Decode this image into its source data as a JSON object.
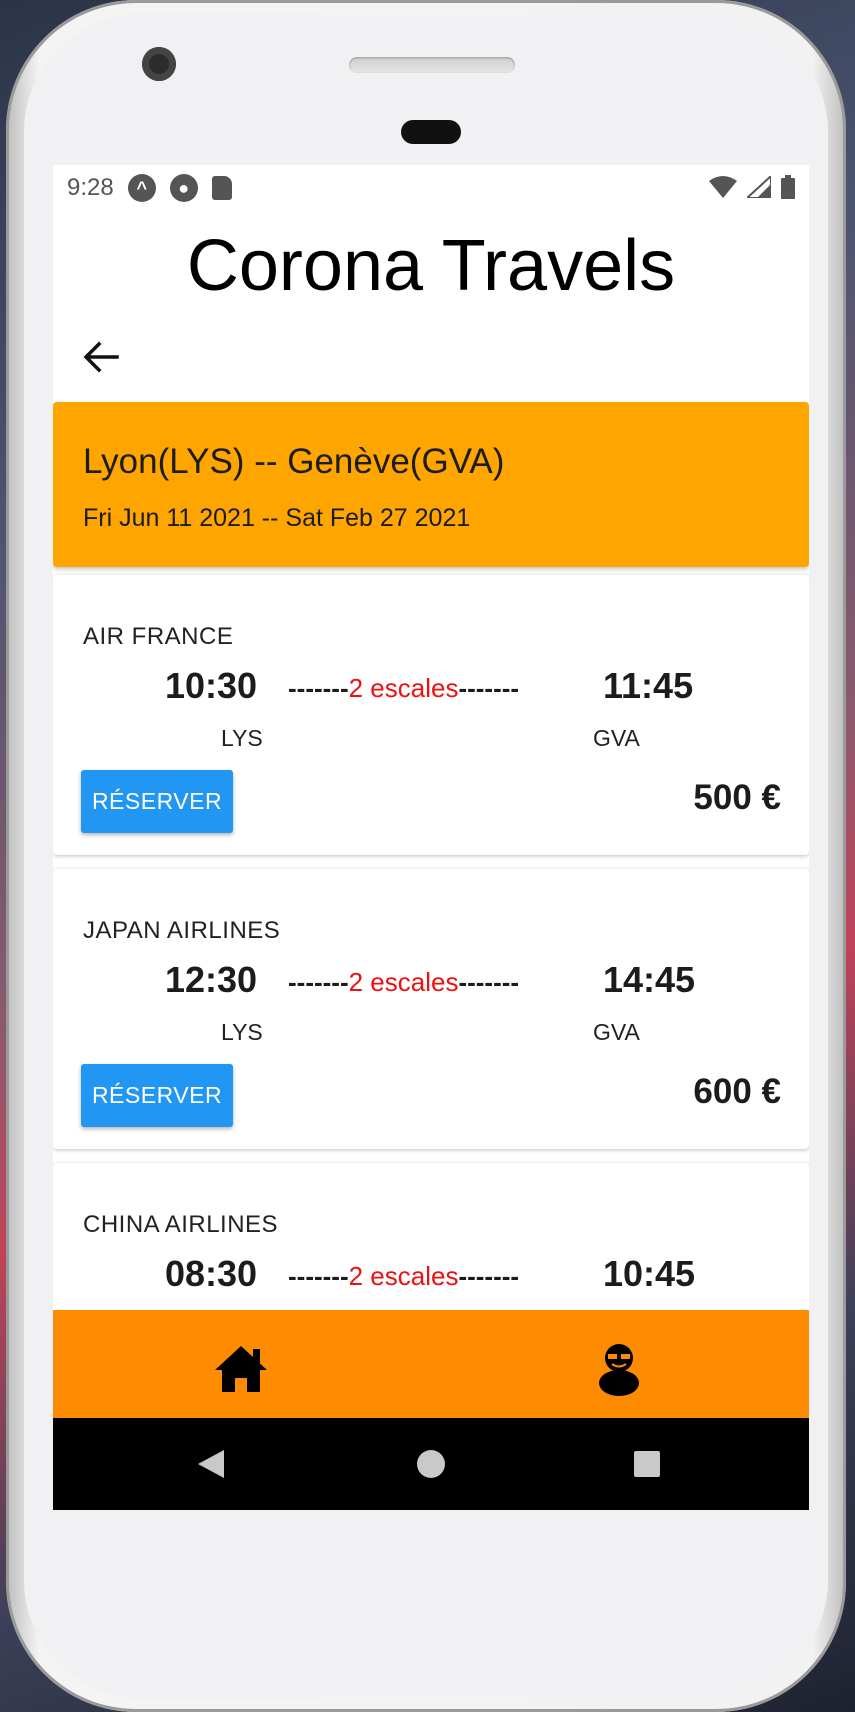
{
  "status_bar": {
    "time": "9:28",
    "icons": [
      "app-notification-icon",
      "notification-icon",
      "sd-card-icon",
      "wifi-icon",
      "signal-icon",
      "battery-icon"
    ]
  },
  "app": {
    "title": "Corona Travels",
    "back_icon": "arrow-left-icon"
  },
  "search": {
    "route": "Lyon(LYS) -- Genève(GVA)",
    "dates": "Fri Jun 11 2021 -- Sat Feb 27 2021"
  },
  "flights": [
    {
      "airline": "AIR FRANCE",
      "departure_time": "10:30",
      "arrival_time": "11:45",
      "dash_left": "-------",
      "stops": "2 escales",
      "dash_right": "-------",
      "departure_code": "LYS",
      "arrival_code": "GVA",
      "book_label": "RÉSERVER",
      "price": "500 €"
    },
    {
      "airline": "JAPAN AIRLINES",
      "departure_time": "12:30",
      "arrival_time": "14:45",
      "dash_left": "-------",
      "stops": "2 escales",
      "dash_right": "-------",
      "departure_code": "LYS",
      "arrival_code": "GVA",
      "book_label": "RÉSERVER",
      "price": "600 €"
    },
    {
      "airline": "CHINA AIRLINES",
      "departure_time": "08:30",
      "arrival_time": "10:45",
      "dash_left": "-------",
      "stops": "2 escales",
      "dash_right": "-------"
    }
  ],
  "bottom_nav": {
    "items": [
      "home-icon",
      "profile-avatar-icon"
    ]
  },
  "colors": {
    "route_header": "#ffa500",
    "bottom_nav": "#ff8c00",
    "book_button": "#2196f3",
    "stops_text": "#ee1111"
  }
}
